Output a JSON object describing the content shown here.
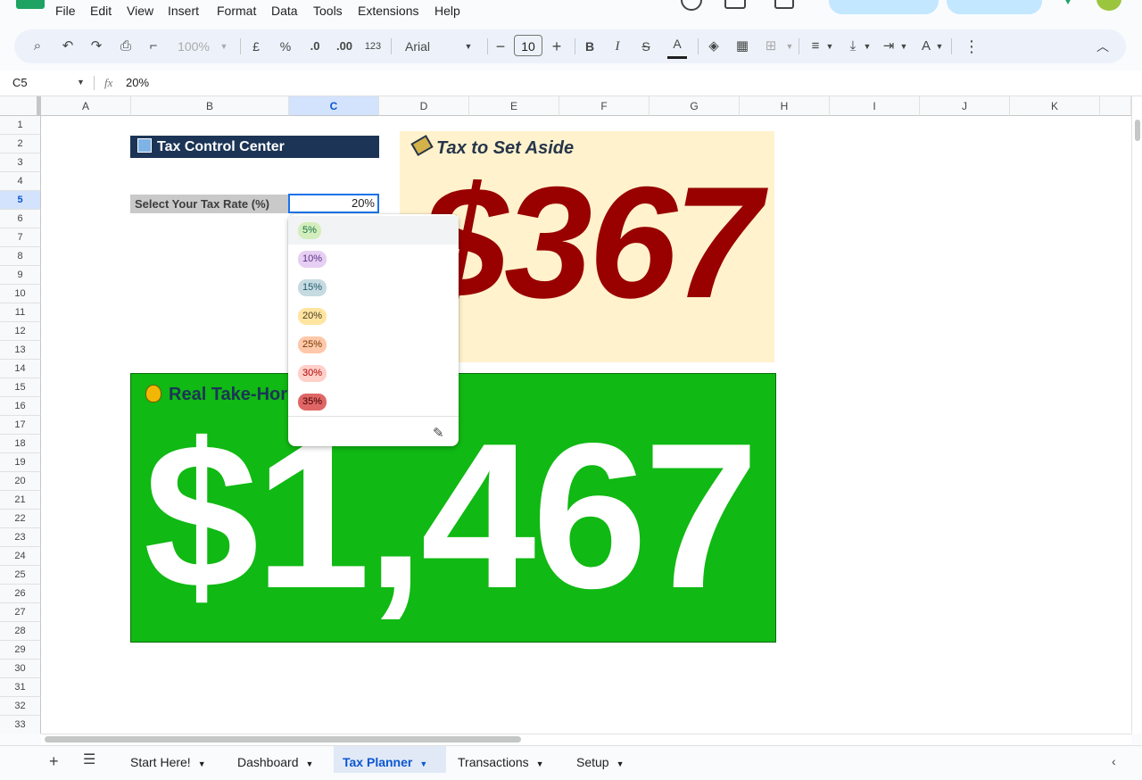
{
  "menu": [
    "File",
    "Edit",
    "View",
    "Insert",
    "Format",
    "Data",
    "Tools",
    "Extensions",
    "Help"
  ],
  "toolbar": {
    "zoom": "100%",
    "currency": "£",
    "percent": "%",
    "dec_less": ".0",
    "dec_more": ".00",
    "number_format": "123",
    "font": "Arial",
    "font_size": "10",
    "bold": "B",
    "italic": "I",
    "strike": "S",
    "text_color": "A"
  },
  "formula_bar": {
    "cell_ref": "C5",
    "fx": "fx",
    "value": "20%"
  },
  "columns": [
    "A",
    "B",
    "C",
    "D",
    "E",
    "F",
    "G",
    "H",
    "I",
    "J",
    "K"
  ],
  "rows": [
    "1",
    "2",
    "3",
    "4",
    "5",
    "6",
    "7",
    "8",
    "9",
    "10",
    "11",
    "12",
    "13",
    "14",
    "15",
    "16",
    "17",
    "18",
    "19",
    "20",
    "21",
    "22",
    "23",
    "24",
    "25",
    "26",
    "27",
    "28",
    "29",
    "30",
    "31",
    "32",
    "33"
  ],
  "selected_column": "C",
  "selected_row": "5",
  "sheet": {
    "title_icon": "office-building-icon",
    "title": "Tax Control Center",
    "rate_label": "Select Your Tax Rate (%)",
    "rate_value": "20%",
    "aside_title": "Tax to Set Aside",
    "aside_amount": "$367",
    "takehome_title": "Real Take-Hor",
    "takehome_amount": "$1,467"
  },
  "dropdown": {
    "options": [
      {
        "label": "5%",
        "bg": "#d4edbc",
        "fg": "#11734b"
      },
      {
        "label": "10%",
        "bg": "#e6cff2",
        "fg": "#5a3286"
      },
      {
        "label": "15%",
        "bg": "#c6dbe1",
        "fg": "#215a6c"
      },
      {
        "label": "20%",
        "bg": "#ffe5a0",
        "fg": "#473821"
      },
      {
        "label": "25%",
        "bg": "#ffc8aa",
        "fg": "#753800"
      },
      {
        "label": "30%",
        "bg": "#ffcfc9",
        "fg": "#b10202"
      },
      {
        "label": "35%",
        "bg": "#e06666",
        "fg": "#3d0000"
      }
    ]
  },
  "tabs": [
    {
      "label": "Start Here!",
      "active": false
    },
    {
      "label": "Dashboard",
      "active": false
    },
    {
      "label": "Tax Planner",
      "active": true
    },
    {
      "label": "Transactions",
      "active": false
    },
    {
      "label": "Setup",
      "active": false
    }
  ],
  "colors": {
    "accent": "#0b57d0",
    "title_bar": "#1c3556",
    "aside_bg": "#fff2cc",
    "aside_amount": "#990000",
    "takehome_bg": "#10b913"
  }
}
